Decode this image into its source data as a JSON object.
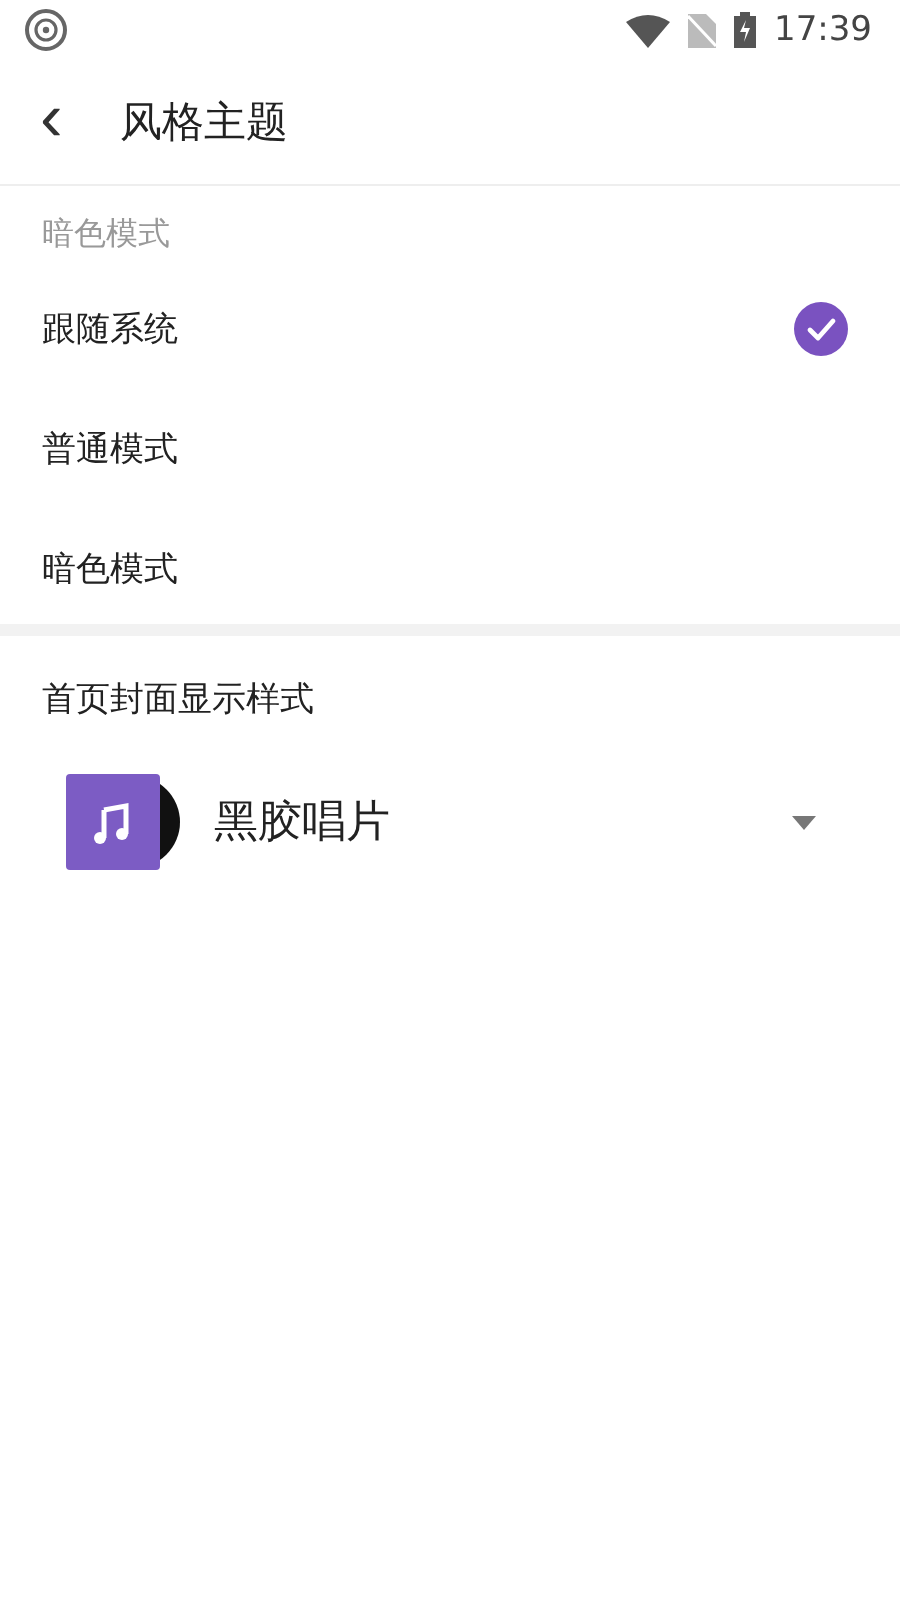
{
  "status_bar": {
    "time": "17:39"
  },
  "header": {
    "back": "‹",
    "title": "风格主题"
  },
  "dark_mode": {
    "heading": "暗色模式",
    "options": [
      {
        "label": "跟随系统",
        "selected": true
      },
      {
        "label": "普通模式",
        "selected": false
      },
      {
        "label": "暗色模式",
        "selected": false
      }
    ]
  },
  "cover_style": {
    "heading": "首页封面显示样式",
    "value": "黑胶唱片"
  }
}
